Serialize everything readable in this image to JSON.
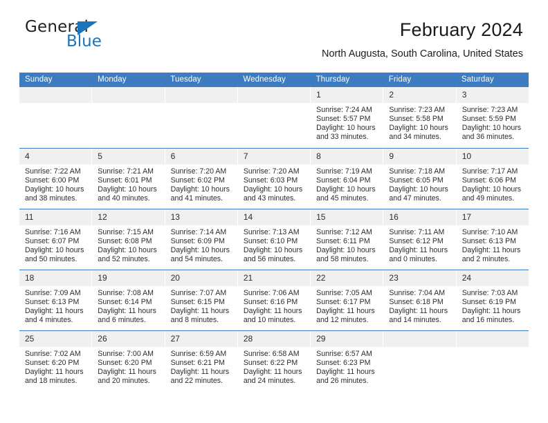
{
  "brand": {
    "name_top": "General",
    "name_bottom": "Blue",
    "accent_color": "#1b75bc"
  },
  "header": {
    "title": "February 2024",
    "subtitle": "North Augusta, South Carolina, United States"
  },
  "calendar": {
    "header_bg": "#3d7cc0",
    "daynum_bg": "#f0f0f0",
    "weekdays": [
      "Sunday",
      "Monday",
      "Tuesday",
      "Wednesday",
      "Thursday",
      "Friday",
      "Saturday"
    ],
    "labels": {
      "sunrise": "Sunrise:",
      "sunset": "Sunset:",
      "daylight": "Daylight:"
    },
    "weeks": [
      [
        {
          "day": "",
          "empty": true
        },
        {
          "day": "",
          "empty": true
        },
        {
          "day": "",
          "empty": true
        },
        {
          "day": "",
          "empty": true
        },
        {
          "day": "1",
          "sunrise": "Sunrise: 7:24 AM",
          "sunset": "Sunset: 5:57 PM",
          "daylight1": "Daylight: 10 hours",
          "daylight2": "and 33 minutes."
        },
        {
          "day": "2",
          "sunrise": "Sunrise: 7:23 AM",
          "sunset": "Sunset: 5:58 PM",
          "daylight1": "Daylight: 10 hours",
          "daylight2": "and 34 minutes."
        },
        {
          "day": "3",
          "sunrise": "Sunrise: 7:23 AM",
          "sunset": "Sunset: 5:59 PM",
          "daylight1": "Daylight: 10 hours",
          "daylight2": "and 36 minutes."
        }
      ],
      [
        {
          "day": "4",
          "sunrise": "Sunrise: 7:22 AM",
          "sunset": "Sunset: 6:00 PM",
          "daylight1": "Daylight: 10 hours",
          "daylight2": "and 38 minutes."
        },
        {
          "day": "5",
          "sunrise": "Sunrise: 7:21 AM",
          "sunset": "Sunset: 6:01 PM",
          "daylight1": "Daylight: 10 hours",
          "daylight2": "and 40 minutes."
        },
        {
          "day": "6",
          "sunrise": "Sunrise: 7:20 AM",
          "sunset": "Sunset: 6:02 PM",
          "daylight1": "Daylight: 10 hours",
          "daylight2": "and 41 minutes."
        },
        {
          "day": "7",
          "sunrise": "Sunrise: 7:20 AM",
          "sunset": "Sunset: 6:03 PM",
          "daylight1": "Daylight: 10 hours",
          "daylight2": "and 43 minutes."
        },
        {
          "day": "8",
          "sunrise": "Sunrise: 7:19 AM",
          "sunset": "Sunset: 6:04 PM",
          "daylight1": "Daylight: 10 hours",
          "daylight2": "and 45 minutes."
        },
        {
          "day": "9",
          "sunrise": "Sunrise: 7:18 AM",
          "sunset": "Sunset: 6:05 PM",
          "daylight1": "Daylight: 10 hours",
          "daylight2": "and 47 minutes."
        },
        {
          "day": "10",
          "sunrise": "Sunrise: 7:17 AM",
          "sunset": "Sunset: 6:06 PM",
          "daylight1": "Daylight: 10 hours",
          "daylight2": "and 49 minutes."
        }
      ],
      [
        {
          "day": "11",
          "sunrise": "Sunrise: 7:16 AM",
          "sunset": "Sunset: 6:07 PM",
          "daylight1": "Daylight: 10 hours",
          "daylight2": "and 50 minutes."
        },
        {
          "day": "12",
          "sunrise": "Sunrise: 7:15 AM",
          "sunset": "Sunset: 6:08 PM",
          "daylight1": "Daylight: 10 hours",
          "daylight2": "and 52 minutes."
        },
        {
          "day": "13",
          "sunrise": "Sunrise: 7:14 AM",
          "sunset": "Sunset: 6:09 PM",
          "daylight1": "Daylight: 10 hours",
          "daylight2": "and 54 minutes."
        },
        {
          "day": "14",
          "sunrise": "Sunrise: 7:13 AM",
          "sunset": "Sunset: 6:10 PM",
          "daylight1": "Daylight: 10 hours",
          "daylight2": "and 56 minutes."
        },
        {
          "day": "15",
          "sunrise": "Sunrise: 7:12 AM",
          "sunset": "Sunset: 6:11 PM",
          "daylight1": "Daylight: 10 hours",
          "daylight2": "and 58 minutes."
        },
        {
          "day": "16",
          "sunrise": "Sunrise: 7:11 AM",
          "sunset": "Sunset: 6:12 PM",
          "daylight1": "Daylight: 11 hours",
          "daylight2": "and 0 minutes."
        },
        {
          "day": "17",
          "sunrise": "Sunrise: 7:10 AM",
          "sunset": "Sunset: 6:13 PM",
          "daylight1": "Daylight: 11 hours",
          "daylight2": "and 2 minutes."
        }
      ],
      [
        {
          "day": "18",
          "sunrise": "Sunrise: 7:09 AM",
          "sunset": "Sunset: 6:13 PM",
          "daylight1": "Daylight: 11 hours",
          "daylight2": "and 4 minutes."
        },
        {
          "day": "19",
          "sunrise": "Sunrise: 7:08 AM",
          "sunset": "Sunset: 6:14 PM",
          "daylight1": "Daylight: 11 hours",
          "daylight2": "and 6 minutes."
        },
        {
          "day": "20",
          "sunrise": "Sunrise: 7:07 AM",
          "sunset": "Sunset: 6:15 PM",
          "daylight1": "Daylight: 11 hours",
          "daylight2": "and 8 minutes."
        },
        {
          "day": "21",
          "sunrise": "Sunrise: 7:06 AM",
          "sunset": "Sunset: 6:16 PM",
          "daylight1": "Daylight: 11 hours",
          "daylight2": "and 10 minutes."
        },
        {
          "day": "22",
          "sunrise": "Sunrise: 7:05 AM",
          "sunset": "Sunset: 6:17 PM",
          "daylight1": "Daylight: 11 hours",
          "daylight2": "and 12 minutes."
        },
        {
          "day": "23",
          "sunrise": "Sunrise: 7:04 AM",
          "sunset": "Sunset: 6:18 PM",
          "daylight1": "Daylight: 11 hours",
          "daylight2": "and 14 minutes."
        },
        {
          "day": "24",
          "sunrise": "Sunrise: 7:03 AM",
          "sunset": "Sunset: 6:19 PM",
          "daylight1": "Daylight: 11 hours",
          "daylight2": "and 16 minutes."
        }
      ],
      [
        {
          "day": "25",
          "sunrise": "Sunrise: 7:02 AM",
          "sunset": "Sunset: 6:20 PM",
          "daylight1": "Daylight: 11 hours",
          "daylight2": "and 18 minutes."
        },
        {
          "day": "26",
          "sunrise": "Sunrise: 7:00 AM",
          "sunset": "Sunset: 6:20 PM",
          "daylight1": "Daylight: 11 hours",
          "daylight2": "and 20 minutes."
        },
        {
          "day": "27",
          "sunrise": "Sunrise: 6:59 AM",
          "sunset": "Sunset: 6:21 PM",
          "daylight1": "Daylight: 11 hours",
          "daylight2": "and 22 minutes."
        },
        {
          "day": "28",
          "sunrise": "Sunrise: 6:58 AM",
          "sunset": "Sunset: 6:22 PM",
          "daylight1": "Daylight: 11 hours",
          "daylight2": "and 24 minutes."
        },
        {
          "day": "29",
          "sunrise": "Sunrise: 6:57 AM",
          "sunset": "Sunset: 6:23 PM",
          "daylight1": "Daylight: 11 hours",
          "daylight2": "and 26 minutes."
        },
        {
          "day": "",
          "empty": true
        },
        {
          "day": "",
          "empty": true
        }
      ]
    ]
  }
}
